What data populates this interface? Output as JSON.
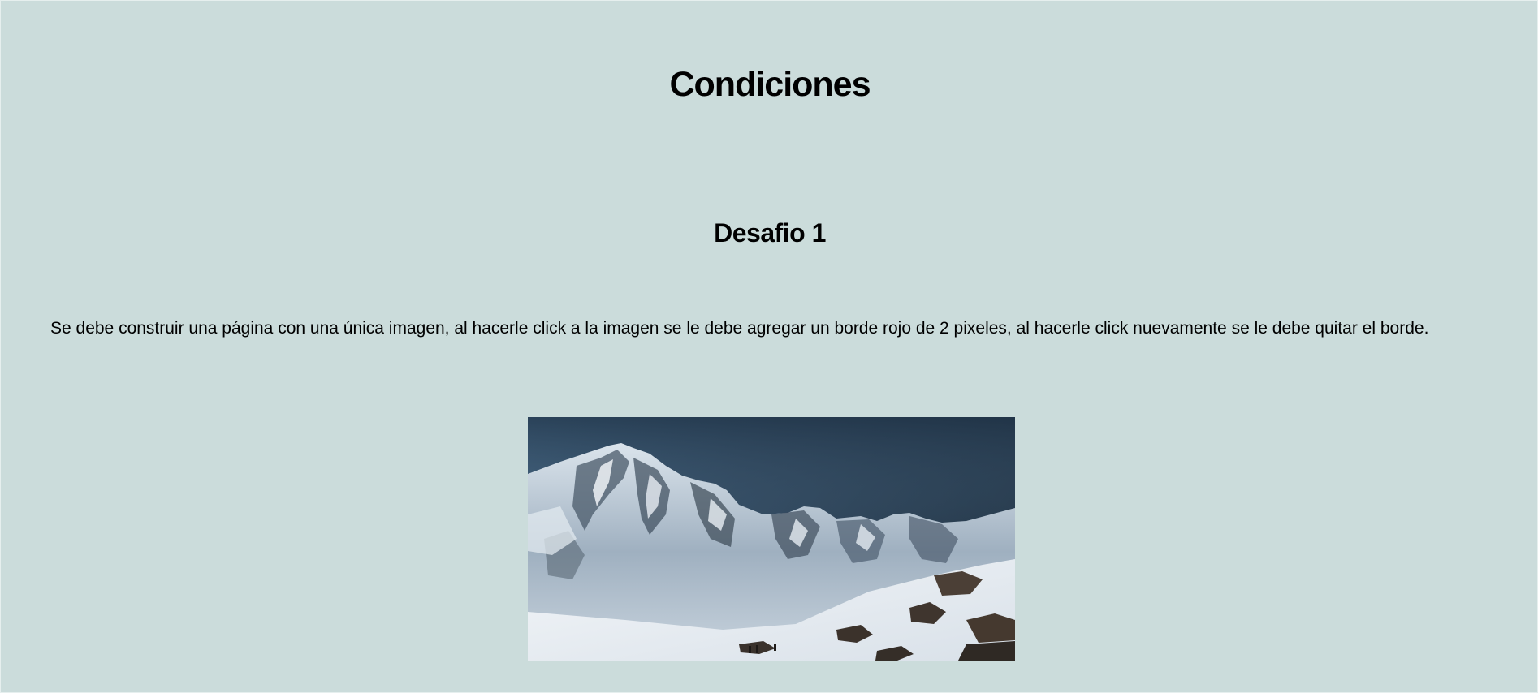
{
  "page": {
    "title": "Condiciones",
    "challenge_title": "Desafio 1",
    "description": "Se debe construir una página con una única imagen, al hacerle click a la imagen se le debe agregar un borde rojo de 2 pixeles, al hacerle click nuevamente se le debe quitar el borde."
  },
  "image": {
    "subject": "snow-capped mountain landscape",
    "border_color_on_click": "#ff0000"
  },
  "colors": {
    "background": "#cbdcdb",
    "text": "#000000"
  }
}
